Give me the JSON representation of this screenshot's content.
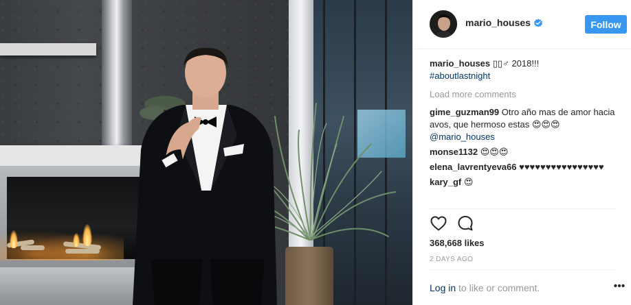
{
  "post": {
    "image_alt": "",
    "author": {
      "username": "mario_houses",
      "verified": true,
      "follow_label": "Follow"
    },
    "caption": {
      "username": "mario_houses",
      "text": "▯▯♂ 2018!!!",
      "hashtag": "#aboutlastnight"
    },
    "load_more_label": "Load more comments",
    "comments": [
      {
        "username": "gime_guzman99",
        "text": "Otro año mas de amor hacia avos, que hermoso estas 😍😍😍",
        "mention": "@mario_houses"
      },
      {
        "username": "monse1132",
        "text": "😍😍😍",
        "mention": ""
      },
      {
        "username": "elena_lavrentyeva66",
        "text": "♥♥♥♥♥♥♥♥♥♥♥♥♥♥♥♥",
        "mention": ""
      },
      {
        "username": "kary_gf",
        "text": "😍",
        "mention": ""
      }
    ],
    "actions": {
      "like_icon": "heart-icon",
      "comment_icon": "speech-bubble-icon"
    },
    "likes_label": "368,668 likes",
    "timestamp": "2 DAYS AGO",
    "login": {
      "link_label": "Log in",
      "rest_text": "to like or comment.",
      "more_label": "•••"
    },
    "colors": {
      "follow_button": "#3897f0",
      "link": "#003569",
      "muted": "#999999",
      "text": "#262626"
    }
  }
}
